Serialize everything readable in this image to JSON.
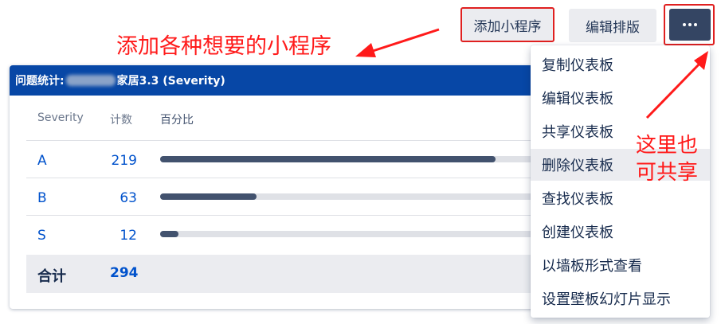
{
  "toolbar": {
    "add_gadget_label": "添加小程序",
    "edit_layout_label": "编辑排版",
    "more_icon": "more-horizontal-icon"
  },
  "annotations": {
    "add_gadget_note": "添加各种想要的小程序",
    "share_note_line1": "这里也",
    "share_note_line2": "可共享",
    "color": "#ff1a1a"
  },
  "gadget": {
    "title_prefix": "问题统计:",
    "title_suffix": "家居3.3 (Severity)",
    "header_color": "#0747a6",
    "columns": {
      "severity": "Severity",
      "count": "计数",
      "percent": "百分比"
    },
    "rows": [
      {
        "label": "A",
        "count": "219",
        "share": 0.745
      },
      {
        "label": "B",
        "count": "63",
        "share": 0.214
      },
      {
        "label": "S",
        "count": "12",
        "share": 0.041
      }
    ],
    "total_label": "合计",
    "total_value": "294"
  },
  "menu": {
    "items": [
      {
        "label": "复制仪表板"
      },
      {
        "label": "编辑仪表板"
      },
      {
        "label": "共享仪表板"
      },
      {
        "label": "删除仪表板",
        "hovered": true
      },
      {
        "label": "查找仪表板"
      },
      {
        "label": "创建仪表板"
      },
      {
        "label": "以墙板形式查看"
      },
      {
        "label": "设置壁板幻灯片显示"
      }
    ]
  }
}
